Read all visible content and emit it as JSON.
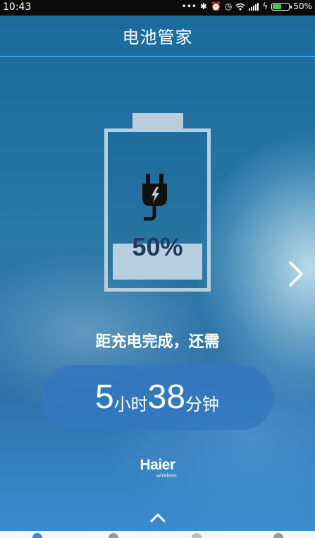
{
  "status_bar": {
    "time": "10:43",
    "icons": [
      "dots-icon",
      "bluetooth-icon",
      "alarm-icon",
      "clock-icon",
      "wifi-icon",
      "signal-icon",
      "charging-icon",
      "battery-icon"
    ],
    "battery_percent": "50%",
    "battery_level": 0.5,
    "battery_color": "#37d34a"
  },
  "header": {
    "title": "电池管家",
    "accent_color": "#3aa3e8"
  },
  "battery": {
    "level_text": "50%",
    "level": 0.5,
    "icon": "charging-plug-icon"
  },
  "charging": {
    "label": "距充电完成，还需",
    "hours": "5",
    "hours_unit": "小时",
    "minutes": "38",
    "minutes_unit": "分钟"
  },
  "brand": {
    "name": "Haier",
    "tagline": "wireless"
  },
  "nav": {
    "next_icon": "chevron-right-icon",
    "expand_icon": "chevron-up-icon"
  }
}
